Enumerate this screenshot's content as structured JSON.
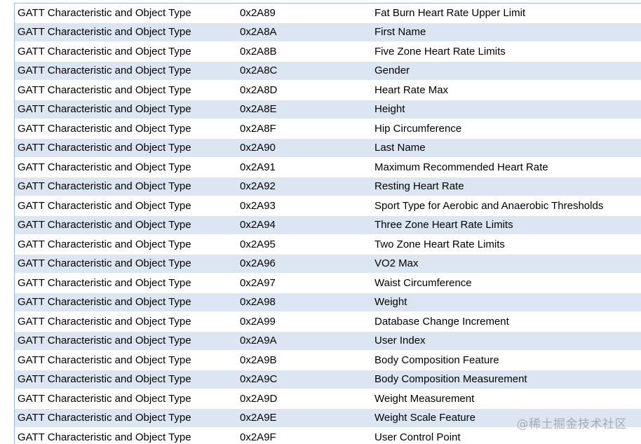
{
  "rows": [
    {
      "type": "GATT Characteristic and Object Type",
      "uuid": "0x2A89",
      "name": "Fat Burn Heart Rate Upper Limit"
    },
    {
      "type": "GATT Characteristic and Object Type",
      "uuid": "0x2A8A",
      "name": "First Name"
    },
    {
      "type": "GATT Characteristic and Object Type",
      "uuid": "0x2A8B",
      "name": "Five Zone Heart Rate Limits"
    },
    {
      "type": "GATT Characteristic and Object Type",
      "uuid": "0x2A8C",
      "name": "Gender"
    },
    {
      "type": "GATT Characteristic and Object Type",
      "uuid": "0x2A8D",
      "name": "Heart Rate Max"
    },
    {
      "type": "GATT Characteristic and Object Type",
      "uuid": "0x2A8E",
      "name": "Height"
    },
    {
      "type": "GATT Characteristic and Object Type",
      "uuid": "0x2A8F",
      "name": "Hip Circumference"
    },
    {
      "type": "GATT Characteristic and Object Type",
      "uuid": "0x2A90",
      "name": "Last Name"
    },
    {
      "type": "GATT Characteristic and Object Type",
      "uuid": "0x2A91",
      "name": "Maximum Recommended Heart Rate"
    },
    {
      "type": "GATT Characteristic and Object Type",
      "uuid": "0x2A92",
      "name": "Resting Heart Rate"
    },
    {
      "type": "GATT Characteristic and Object Type",
      "uuid": "0x2A93",
      "name": "Sport Type for Aerobic and Anaerobic Thresholds"
    },
    {
      "type": "GATT Characteristic and Object Type",
      "uuid": "0x2A94",
      "name": "Three Zone Heart Rate Limits"
    },
    {
      "type": "GATT Characteristic and Object Type",
      "uuid": "0x2A95",
      "name": "Two Zone Heart Rate Limits"
    },
    {
      "type": "GATT Characteristic and Object Type",
      "uuid": "0x2A96",
      "name": "VO2 Max"
    },
    {
      "type": "GATT Characteristic and Object Type",
      "uuid": "0x2A97",
      "name": "Waist Circumference"
    },
    {
      "type": "GATT Characteristic and Object Type",
      "uuid": "0x2A98",
      "name": "Weight"
    },
    {
      "type": "GATT Characteristic and Object Type",
      "uuid": "0x2A99",
      "name": "Database Change Increment"
    },
    {
      "type": "GATT Characteristic and Object Type",
      "uuid": "0x2A9A",
      "name": "User Index"
    },
    {
      "type": "GATT Characteristic and Object Type",
      "uuid": "0x2A9B",
      "name": "Body Composition Feature"
    },
    {
      "type": "GATT Characteristic and Object Type",
      "uuid": "0x2A9C",
      "name": "Body Composition Measurement"
    },
    {
      "type": "GATT Characteristic and Object Type",
      "uuid": "0x2A9D",
      "name": "Weight Measurement"
    },
    {
      "type": "GATT Characteristic and Object Type",
      "uuid": "0x2A9E",
      "name": "Weight Scale Feature"
    },
    {
      "type": "GATT Characteristic and Object Type",
      "uuid": "0x2A9F",
      "name": "User Control Point"
    }
  ],
  "watermark": "@稀土掘金技术社区",
  "colors": {
    "stripe": "#dce6f2",
    "border": "#9bbbe0"
  }
}
